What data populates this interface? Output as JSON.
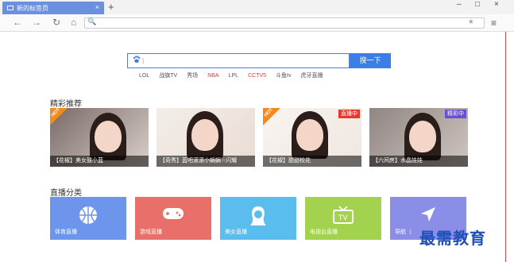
{
  "browser": {
    "tab_title": "新的标签页",
    "tab_close": "×",
    "new_tab": "+",
    "window_controls": {
      "minimize": "–",
      "maximize": "□",
      "close": "×"
    },
    "nav": {
      "back": "←",
      "forward": "→",
      "reload": "↻",
      "home": "⌂"
    },
    "address_icon": "🔍",
    "bookmark_star": "★",
    "menu": "≡"
  },
  "search": {
    "caret": "|",
    "button_label": "搜一下",
    "hot_links": [
      {
        "label": "LOL",
        "highlight": false
      },
      {
        "label": "战旗TV",
        "highlight": false
      },
      {
        "label": "秀场",
        "highlight": false
      },
      {
        "label": "NBA",
        "highlight": true
      },
      {
        "label": "LPL",
        "highlight": false
      },
      {
        "label": "CCTV5",
        "highlight": true
      },
      {
        "label": "斗鱼tv",
        "highlight": false
      },
      {
        "label": "虎牙直播",
        "highlight": false
      }
    ]
  },
  "featured": {
    "title": "精彩推荐",
    "cards": [
      {
        "caption": "【花椒】美女鼓小蓝",
        "badge": "HOT",
        "badge_type": "corner"
      },
      {
        "caption": "【奇秀】蓝吧滚滚小蜗蜗☆闪耀",
        "badge": "",
        "badge_type": "none"
      },
      {
        "caption": "【花椒】甜甜校花",
        "badge": "HOT",
        "badge_type": "corner",
        "status": "直播中"
      },
      {
        "caption": "【六间房】水晶娃娃",
        "badge": "",
        "badge_type": "none",
        "status": "精彩中"
      }
    ]
  },
  "categories": {
    "title": "直播分类",
    "items": [
      {
        "label": "体育直播",
        "icon": "basketball-icon",
        "color": "#6d95ec"
      },
      {
        "label": "游戏直播",
        "icon": "gamepad-icon",
        "color": "#e9706a"
      },
      {
        "label": "美女直播",
        "icon": "woman-icon",
        "color": "#5bbcee"
      },
      {
        "label": "电视台直播",
        "icon": "tv-icon",
        "color": "#a2d24e"
      },
      {
        "label": "导航（",
        "icon": "navigation-arrow-icon",
        "color": "#8a8ee6"
      }
    ]
  },
  "watermark": "最需教育"
}
